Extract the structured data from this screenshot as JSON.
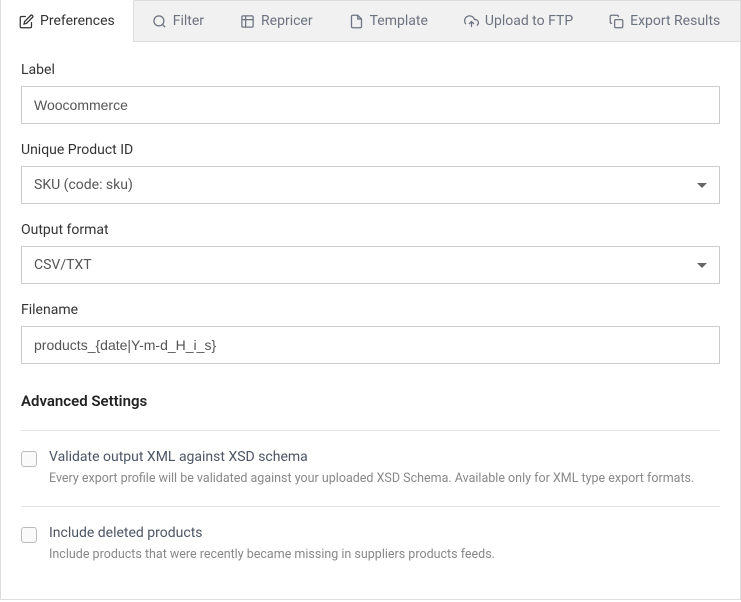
{
  "tabs": [
    {
      "label": "Preferences",
      "active": true
    },
    {
      "label": "Filter",
      "active": false
    },
    {
      "label": "Repricer",
      "active": false
    },
    {
      "label": "Template",
      "active": false
    },
    {
      "label": "Upload to FTP",
      "active": false
    },
    {
      "label": "Export Results",
      "active": false
    }
  ],
  "form": {
    "label_label": "Label",
    "label_value": "Woocommerce",
    "product_id_label": "Unique Product ID",
    "product_id_value": "SKU (code: sku)",
    "output_format_label": "Output format",
    "output_format_value": "CSV/TXT",
    "filename_label": "Filename",
    "filename_value": "products_{date|Y-m-d_H_i_s}"
  },
  "advanced": {
    "heading": "Advanced Settings",
    "validate_label": "Validate output XML against XSD schema",
    "validate_help": "Every export profile will be validated against your uploaded XSD Schema. Available only for XML type export formats.",
    "include_deleted_label": "Include deleted products",
    "include_deleted_help": "Include products that were recently became missing in suppliers products feeds."
  }
}
